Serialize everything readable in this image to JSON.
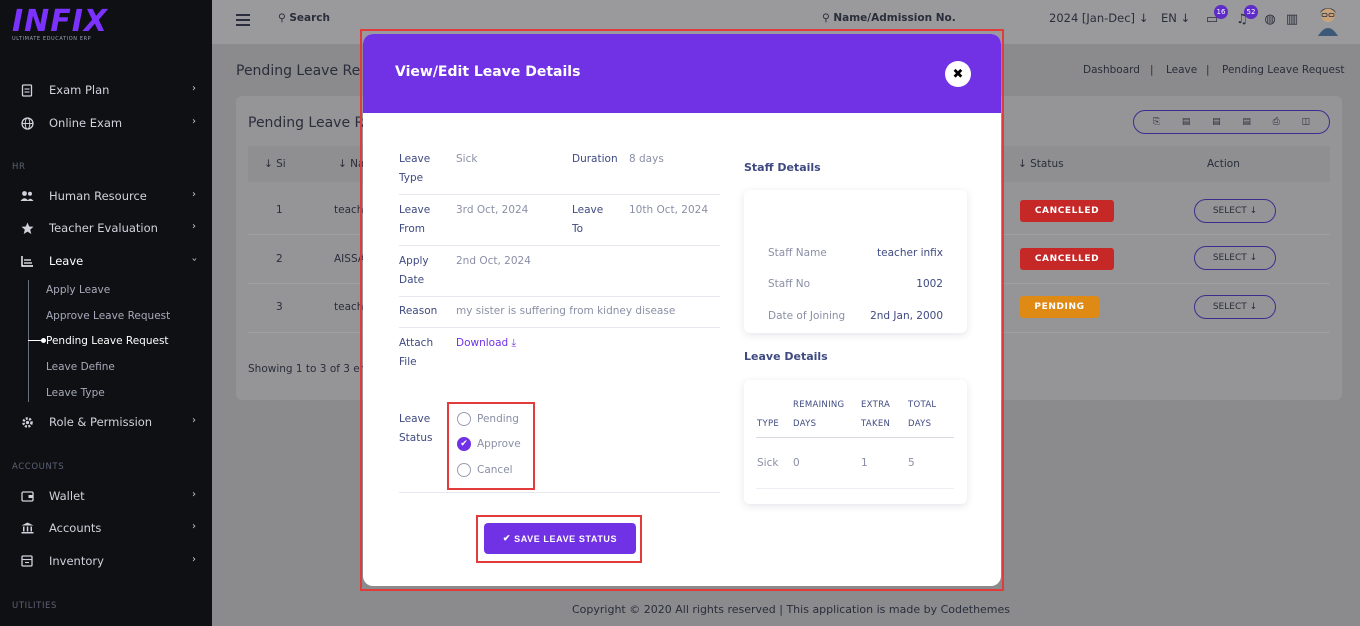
{
  "brand": {
    "logo": "INFIX",
    "tagline": "ULTIMATE EDUCATION ERP"
  },
  "sidebar": {
    "items_top": [
      {
        "label": "Exam Plan",
        "icon": "document-icon"
      },
      {
        "label": "Online Exam",
        "icon": "globe-icon"
      }
    ],
    "section_hr": "HR",
    "items_hr": [
      {
        "label": "Human Resource",
        "icon": "users-icon"
      },
      {
        "label": "Teacher Evaluation",
        "icon": "star-icon"
      },
      {
        "label": "Leave",
        "icon": "leave-icon"
      }
    ],
    "leave_sub": [
      "Apply Leave",
      "Approve Leave Request",
      "Pending Leave Request",
      "Leave Define",
      "Leave Type"
    ],
    "role": {
      "label": "Role & Permission",
      "icon": "gear-icon"
    },
    "section_accounts": "ACCOUNTS",
    "items_accounts": [
      {
        "label": "Wallet",
        "icon": "wallet-icon"
      },
      {
        "label": "Accounts",
        "icon": "bank-icon"
      },
      {
        "label": "Inventory",
        "icon": "inventory-icon"
      }
    ],
    "section_utilities": "UTILITIES"
  },
  "topbar": {
    "search_label": "Search",
    "name_search_label": "Name/Admission No.",
    "year": "2024 [Jan-Dec]",
    "lang": "EN",
    "chat_badge": "16",
    "notif_badge": "52"
  },
  "background": {
    "page_title": "Pending Leave Re",
    "breadcrumb": [
      "Dashboard",
      "Leave",
      "Pending Leave Request"
    ],
    "card_title": "Pending Leave R",
    "columns": {
      "si": "Si",
      "name": "Na",
      "status": "Status",
      "action": "Action"
    },
    "rows": [
      {
        "si": "1",
        "name": "teach",
        "status": "CANCELLED"
      },
      {
        "si": "2",
        "name": "AISSA",
        "status": "CANCELLED"
      },
      {
        "si": "3",
        "name": "teach",
        "status": "PENDING"
      }
    ],
    "select_label": "SELECT",
    "showing": "Showing 1 to 3 of 3 ent",
    "footer": "Copyright © 2020 All rights reserved | This application is made by Codethemes"
  },
  "modal": {
    "title": "View/Edit Leave Details",
    "fields": {
      "leave_type_label": [
        "Leave",
        "Type"
      ],
      "leave_type_value": "Sick",
      "duration_label": "Duration",
      "duration_value": "8 days",
      "leave_from_label": [
        "Leave",
        "From"
      ],
      "leave_from_value": "3rd Oct, 2024",
      "leave_to_label": [
        "Leave",
        "To"
      ],
      "leave_to_value": "10th Oct, 2024",
      "apply_date_label": [
        "Apply",
        "Date"
      ],
      "apply_date_value": "2nd Oct, 2024",
      "reason_label": "Reason",
      "reason_value": "my sister is suffering from kidney disease",
      "attach_label": [
        "Attach",
        "File"
      ],
      "attach_value": "Download",
      "status_label": [
        "Leave",
        "Status"
      ]
    },
    "status_options": [
      {
        "label": "Pending",
        "checked": false
      },
      {
        "label": "Approve",
        "checked": true
      },
      {
        "label": "Cancel",
        "checked": false
      }
    ],
    "save_label": "SAVE LEAVE STATUS",
    "staff_title": "Staff Details",
    "staff": [
      {
        "key": "Staff Name",
        "value": "teacher infix"
      },
      {
        "key": "Staff No",
        "value": "1002"
      },
      {
        "key": "Date of Joining",
        "value": "2nd Jan, 2000"
      }
    ],
    "leave_details_title": "Leave Details",
    "leave_table": {
      "headers": [
        "TYPE",
        [
          "REMAINING",
          "DAYS"
        ],
        [
          "EXTRA",
          "TAKEN"
        ],
        [
          "TOTAL",
          "DAYS"
        ]
      ],
      "row": [
        "Sick",
        "0",
        "1",
        "5"
      ]
    }
  },
  "colors": {
    "accent": "#7132e6",
    "highlight": "#e23b3b",
    "cancelled": "#c62828",
    "pending": "#e08a16"
  }
}
